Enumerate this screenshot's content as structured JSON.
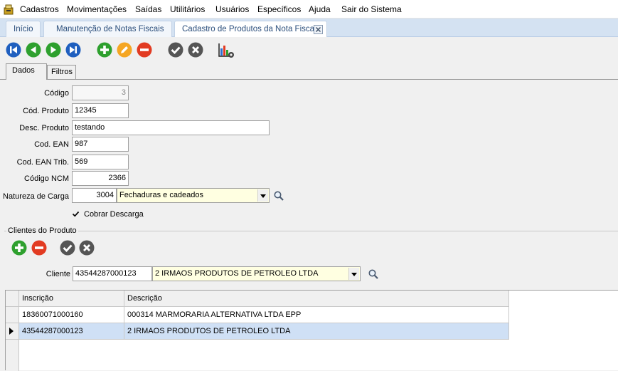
{
  "menu": {
    "items": [
      "Cadastros",
      "Movimentações",
      "Saídas",
      "Utilitários",
      "Usuários",
      "Específicos",
      "Ajuda",
      "Sair do Sistema"
    ]
  },
  "tabs": [
    {
      "label": "Início"
    },
    {
      "label": "Manutenção de Notas Fiscais"
    },
    {
      "label": "Cadastro de Produtos da Nota Fiscal"
    }
  ],
  "toolbar": {
    "icons": [
      "first-record-icon",
      "previous-record-icon",
      "next-record-icon",
      "last-record-icon",
      "add-icon",
      "edit-icon",
      "delete-icon",
      "confirm-icon",
      "cancel-icon",
      "report-settings-icon"
    ]
  },
  "inner_tabs": [
    {
      "label": "Dados"
    },
    {
      "label": "Filtros"
    }
  ],
  "form": {
    "codigo": {
      "label": "Código",
      "value": "3"
    },
    "cod_produto": {
      "label": "Cód. Produto",
      "value": "12345"
    },
    "desc_produto": {
      "label": "Desc. Produto",
      "value": "testando"
    },
    "cod_ean": {
      "label": "Cod. EAN",
      "value": "987"
    },
    "cod_ean_trib": {
      "label": "Cod. EAN Trib.",
      "value": "569"
    },
    "codigo_ncm": {
      "label": "Código NCM",
      "value": "2366"
    },
    "natureza_carga": {
      "label": "Natureza de Carga",
      "code": "3004",
      "description": "Fechaduras e cadeados"
    },
    "cobrar_descarga": {
      "label": "Cobrar Descarga",
      "checked": true
    }
  },
  "clientes": {
    "group_label": "Clientes do Produto",
    "cliente_label": "Cliente",
    "cliente_code": "43544287000123",
    "cliente_name": "2 IRMAOS PRODUTOS DE PETROLEO LTDA",
    "columns": [
      "Inscrição",
      "Descrição"
    ],
    "rows": [
      {
        "inscricao": "18360071000160",
        "descricao": "000314 MARMORARIA ALTERNATIVA LTDA EPP"
      },
      {
        "inscricao": "43544287000123",
        "descricao": "2 IRMAOS PRODUTOS DE PETROLEO LTDA"
      }
    ],
    "selected_row": 1
  },
  "colors": {
    "blue_nav": "#1f5fbf",
    "green_nav": "#2ea02e",
    "orange_edit": "#f5a623",
    "red_delete": "#e23b22",
    "gray_action": "#555555"
  }
}
